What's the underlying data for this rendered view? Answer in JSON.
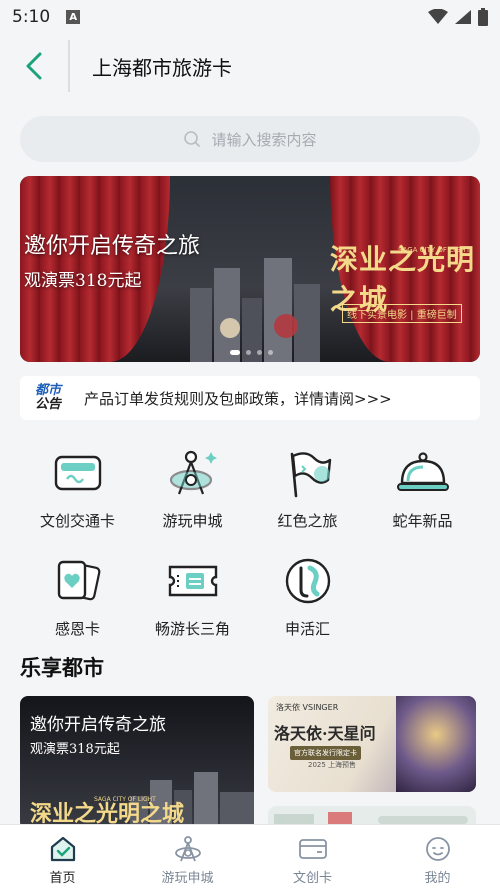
{
  "status_bar": {
    "time": "5:10",
    "notification_letter": "A"
  },
  "header": {
    "title": "上海都市旅游卡",
    "back_icon": "chevron-left-icon"
  },
  "search": {
    "placeholder": "请输入搜索内容"
  },
  "banner": {
    "line1": "邀你开启传奇之旅",
    "line2": "观演票318元起",
    "logo": "深业之光明之城",
    "logo_en": "SAGA CITY OF LIGHT",
    "tag": "线下实景电影 | 重磅巨制",
    "slide_count": 4,
    "active_slide": 1
  },
  "notice": {
    "badge_line1": "都市",
    "badge_line2": "公告",
    "text": "产品订单发货规则及包邮政策，详情请阅>>>"
  },
  "grid": {
    "items": [
      {
        "label": "文创交通卡",
        "icon": "transit-card-icon"
      },
      {
        "label": "游玩申城",
        "icon": "city-tower-icon"
      },
      {
        "label": "红色之旅",
        "icon": "flag-icon"
      },
      {
        "label": "蛇年新品",
        "icon": "food-cloche-icon"
      },
      {
        "label": "感恩卡",
        "icon": "heart-card-icon"
      },
      {
        "label": "畅游长三角",
        "icon": "ticket-icon"
      },
      {
        "label": "申活汇",
        "icon": "circle-badge-icon"
      }
    ]
  },
  "section": {
    "title": "乐享都市"
  },
  "cards": {
    "card1": {
      "line1": "邀你开启传奇之旅",
      "line2": "观演票318元起",
      "logo": "深业之光明之城",
      "logo_en": "SAGA CITY OF LIGHT"
    },
    "card2": {
      "brand": "洛天依 VSINGER",
      "title": "洛天依·天星问",
      "sub": "官方联名发行限定卡",
      "sub2": "2025 上海预售"
    }
  },
  "tabbar": {
    "tabs": [
      {
        "label": "首页",
        "icon": "home-icon",
        "active": true
      },
      {
        "label": "游玩申城",
        "icon": "tower-icon",
        "active": false
      },
      {
        "label": "文创卡",
        "icon": "card-icon",
        "active": false
      },
      {
        "label": "我的",
        "icon": "profile-icon",
        "active": false
      }
    ]
  },
  "colors": {
    "accent": "#1aa37a",
    "icon_teal": "#6ccfc4",
    "notice_blue": "#1e5eb8"
  }
}
